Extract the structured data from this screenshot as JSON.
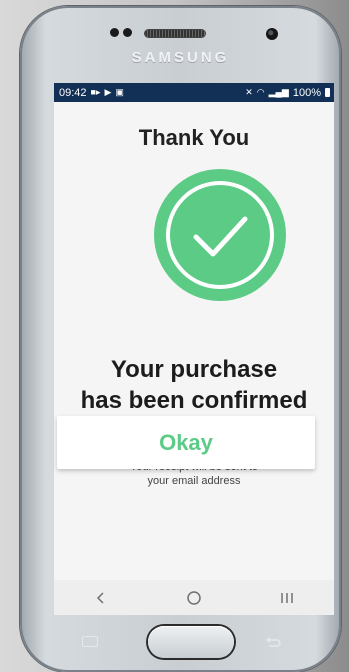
{
  "device": {
    "brand": "SAMSUNG"
  },
  "status_bar": {
    "time": "09:42",
    "battery": "100%"
  },
  "page": {
    "title": "Thank You",
    "headline_line1": "Your purchase",
    "headline_line2": "has been confirmed",
    "receipt_line1": "Your receipt will be sent to",
    "receipt_line2": "your email address",
    "button_label": "Okay"
  },
  "colors": {
    "accent": "#5ccb86",
    "status_bar": "#123055",
    "background": "#f5f5f5"
  },
  "icons": {
    "success": "check-circle-icon",
    "nav_back": "chevron-left-icon",
    "nav_home": "circle-home-icon",
    "nav_recent": "recent-apps-icon"
  }
}
